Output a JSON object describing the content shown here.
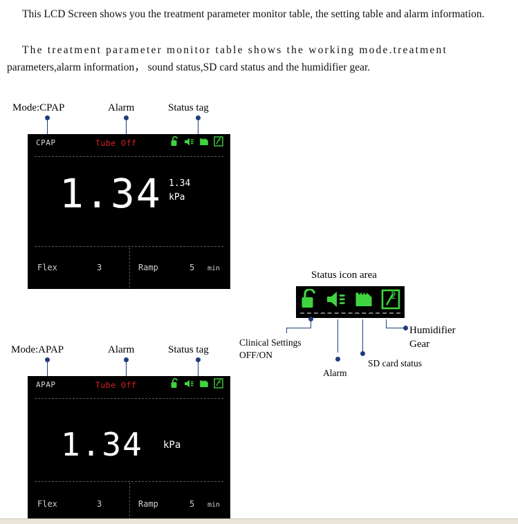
{
  "paragraphs": {
    "p1": "This LCD Screen shows you the treatment parameter monitor table, the setting table and alarm information.",
    "p2_line1": "The treatment parameter monitor table shows the working mode.treatment",
    "p2_line2": "parameters,alarm information，   sound status,SD card status and the humidifier gear."
  },
  "screens": [
    {
      "mode": "CPAP",
      "alarm": "Tube Off",
      "value": "1.34",
      "small_value": "1.34",
      "unit": "kPa",
      "flex_label": "Flex",
      "flex_value": "3",
      "ramp_label": "Ramp",
      "ramp_value": "5",
      "ramp_unit": "min",
      "icons": [
        "unlock-icon",
        "mute-icon",
        "sd-card-icon",
        "humidifier-gear-icon"
      ]
    },
    {
      "mode": "APAP",
      "alarm": "Tube Off",
      "value": "1.34",
      "small_value": "",
      "unit": "kPa",
      "flex_label": "Flex",
      "flex_value": "3",
      "ramp_label": "Ramp",
      "ramp_value": "5",
      "ramp_unit": "min",
      "icons": [
        "unlock-icon",
        "mute-icon",
        "sd-card-icon",
        "humidifier-gear-icon"
      ]
    }
  ],
  "callouts": {
    "cpap_mode": "Mode:CPAP",
    "cpap_alarm": "Alarm",
    "cpap_status": "Status tag",
    "apap_mode": "Mode:APAP",
    "apap_alarm": "Alarm",
    "apap_status": "Status tag",
    "icon_area_title": "Status icon area",
    "clinical_settings_line1": "Clinical Settings",
    "clinical_settings_line2": "OFF/ON",
    "alarm_icon": "Alarm",
    "sd_card_status": "SD card status",
    "humidifier_line1": "Humidifier",
    "humidifier_line2": "Gear"
  },
  "colors": {
    "lcd_background": "#000000",
    "icon_green": "#3fd43f",
    "alarm_red": "#e02020",
    "leader_blue": "#1f3c7a",
    "value_white": "#ffffff"
  }
}
